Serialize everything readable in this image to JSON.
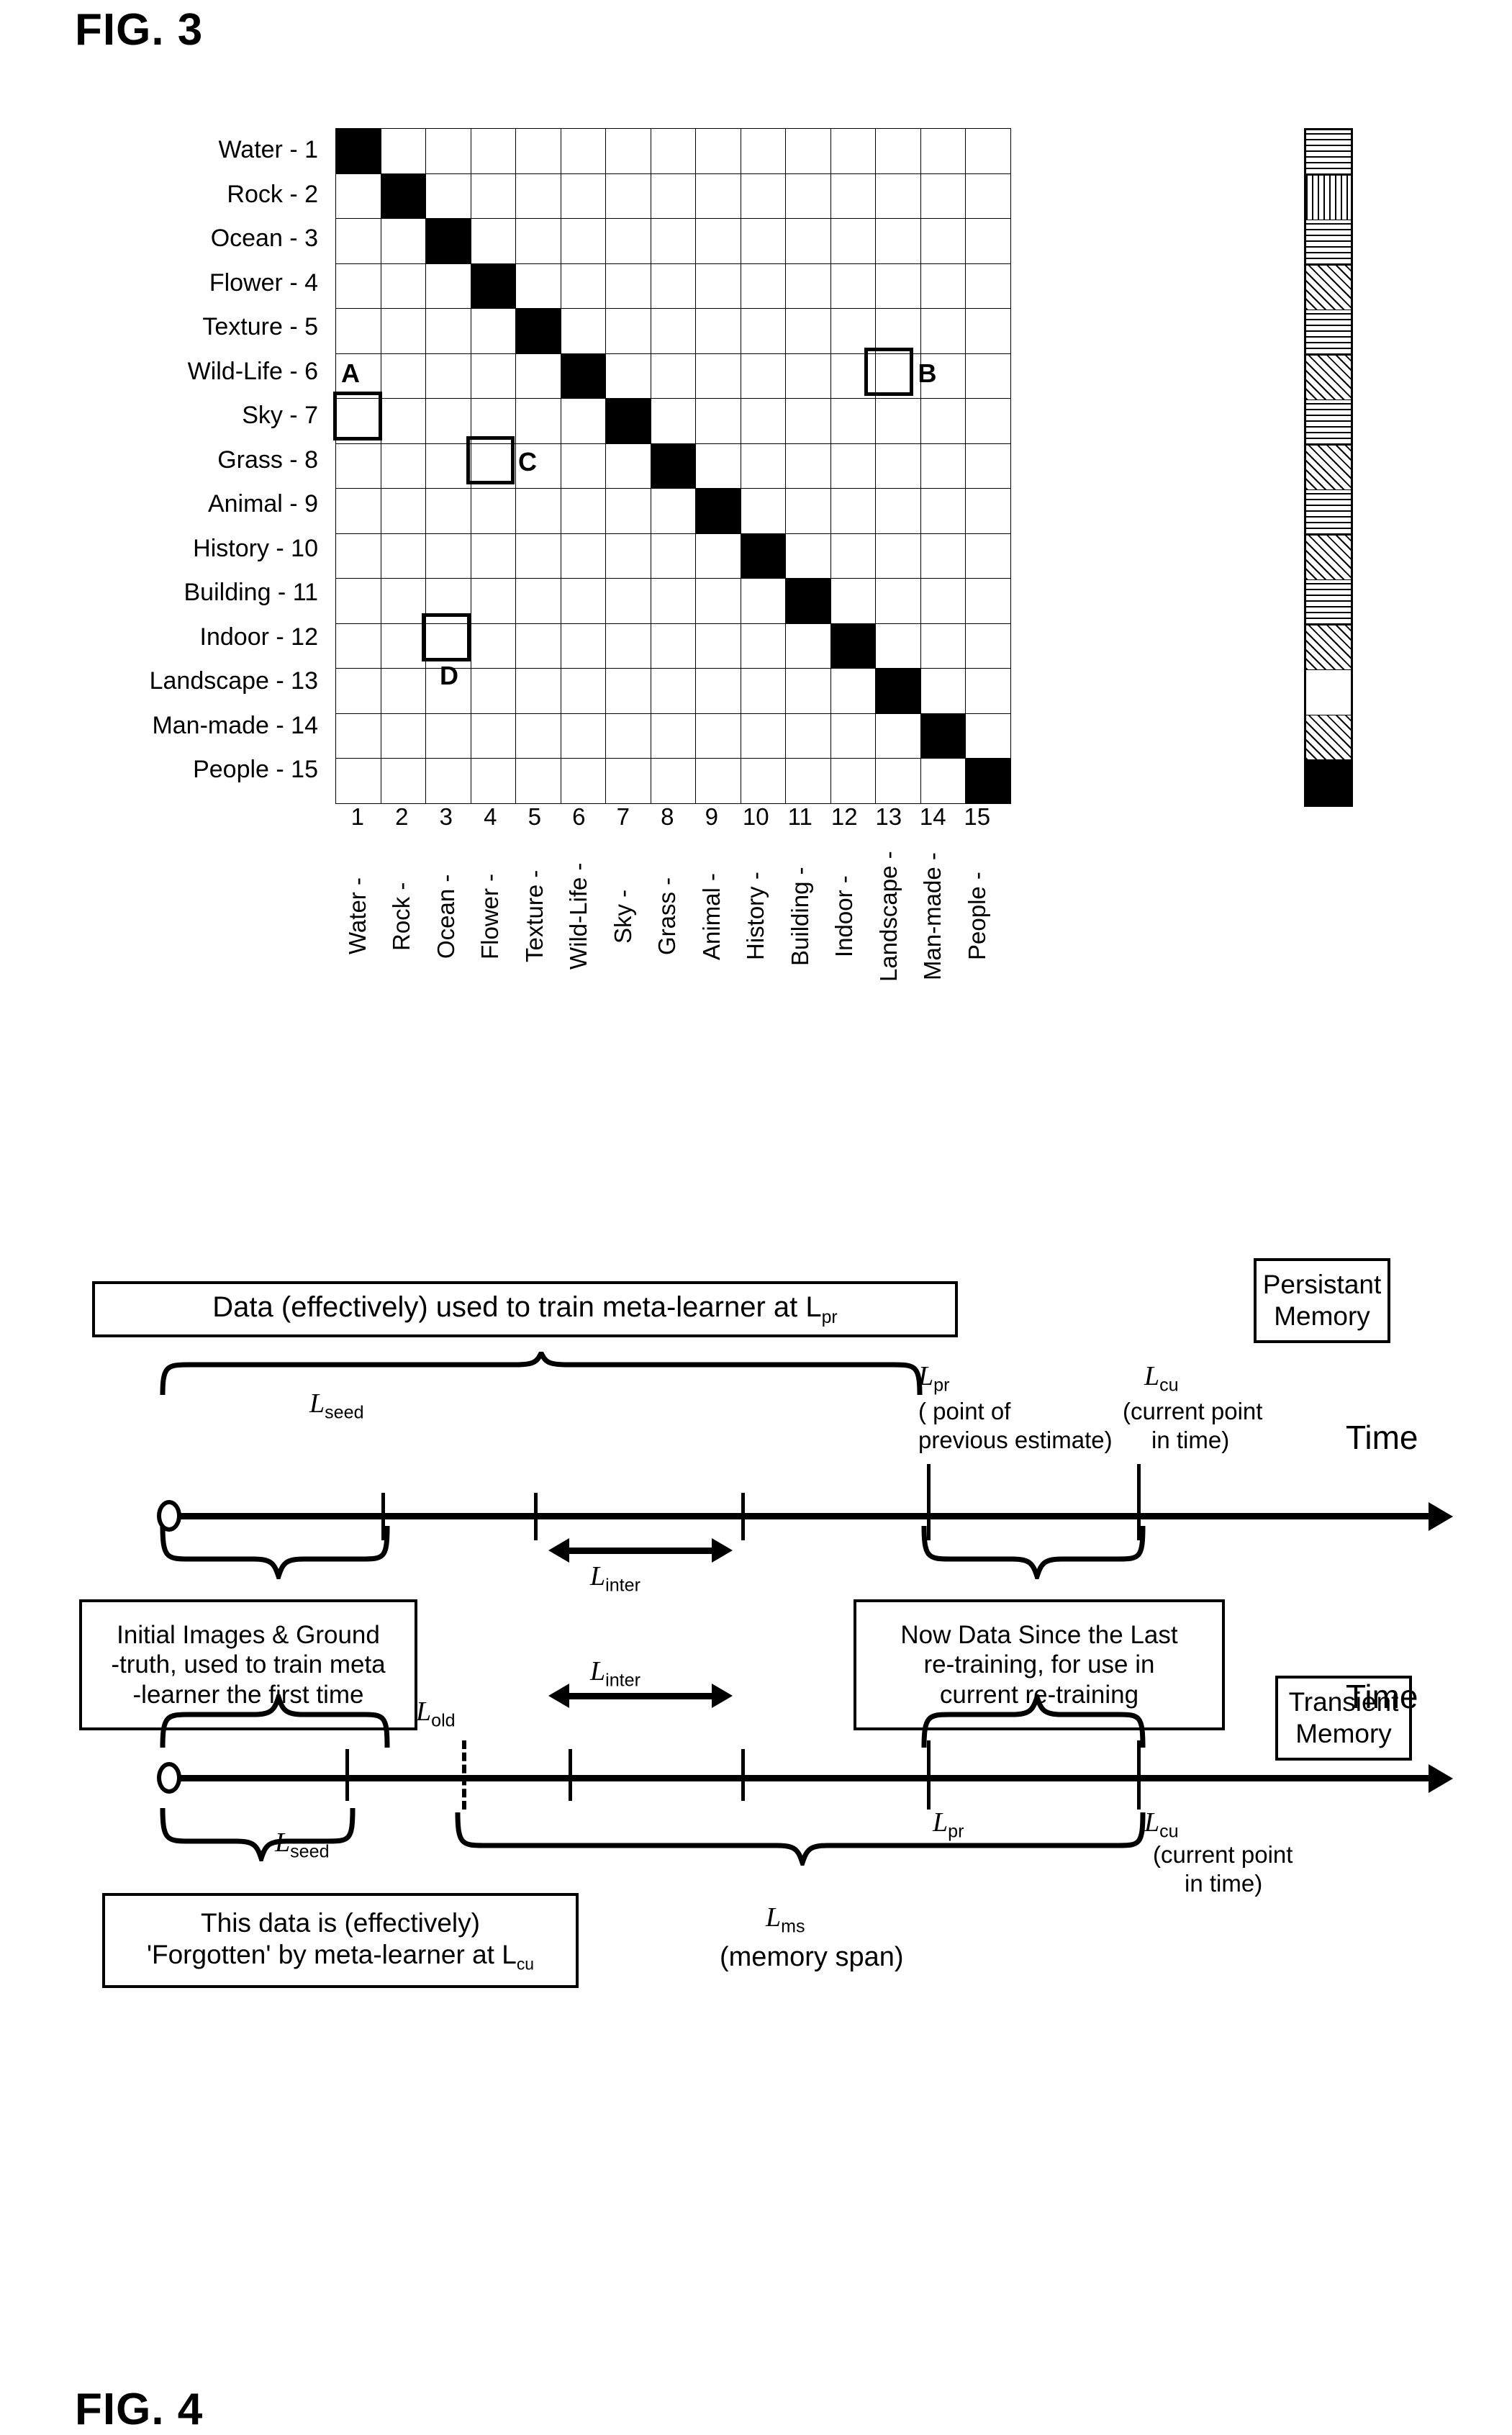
{
  "fig3": {
    "title": "FIG. 3",
    "row_labels": [
      "Water - 1",
      "Rock - 2",
      "Ocean - 3",
      "Flower - 4",
      "Texture - 5",
      "Wild-Life - 6",
      "Sky - 7",
      "Grass - 8",
      "Animal - 9",
      "History - 10",
      "Building - 11",
      "Indoor - 12",
      "Landscape - 13",
      "Man-made - 14",
      "People - 15"
    ],
    "col_numbers": [
      "1",
      "2",
      "3",
      "4",
      "5",
      "6",
      "7",
      "8",
      "9",
      "10",
      "11",
      "12",
      "13",
      "14",
      "15"
    ],
    "col_names": [
      "Water -",
      "Rock -",
      "Ocean -",
      "Flower -",
      "Texture -",
      "Wild-Life -",
      "Sky -",
      "Grass -",
      "Animal -",
      "History -",
      "Building -",
      "Indoor -",
      "Landscape -",
      "Man-made -",
      "People -"
    ],
    "highlights": [
      {
        "label": "A",
        "row": 7,
        "col": 1
      },
      {
        "label": "B",
        "row": 6,
        "col": 13
      },
      {
        "label": "C",
        "row": 8,
        "col": 4
      },
      {
        "label": "D",
        "row": 12,
        "col": 3
      }
    ]
  },
  "fig4": {
    "title": "FIG. 4",
    "top_box": "Data (effectively) used to train meta-learner at L",
    "top_box_sub": "pr",
    "persistent_memory": [
      "Persistant",
      "Memory"
    ],
    "transient_memory": [
      "Transient",
      "Memory"
    ],
    "timeline1": {
      "labels": {
        "seed": "L",
        "seed_sub": "seed",
        "inter": "L",
        "inter_sub": "inter",
        "pr": "L",
        "pr_sub": "pr",
        "pr_note1": "( point of",
        "pr_note2": "previous estimate)",
        "cu": "L",
        "cu_sub": "cu",
        "cu_note1": "(current point",
        "cu_note2": "in time)",
        "time": "Time"
      }
    },
    "timeline2": {
      "labels": {
        "seed": "L",
        "seed_sub": "seed",
        "old": "L",
        "old_sub": "old",
        "inter": "L",
        "inter_sub": "inter",
        "pr": "L",
        "pr_sub": "pr",
        "cu": "L",
        "cu_sub": "cu",
        "cu_note1": "(current point",
        "cu_note2": "in time)",
        "ms": "L",
        "ms_sub": "ms",
        "ms_note": "(memory span)",
        "time": "Time"
      }
    },
    "box_initial": [
      "Initial Images & Ground",
      "-truth, used to train meta",
      "-learner the first time"
    ],
    "box_now": [
      "Now Data Since the Last",
      "re-training, for use in",
      "current re-training"
    ],
    "box_forgotten_l1": "This data is (effectively)",
    "box_forgotten_l2a": "'Forgotten' by meta-learner at L",
    "box_forgotten_l2b": "cu"
  },
  "chart_data": {
    "type": "heatmap",
    "title": "FIG. 3",
    "categories": [
      "Water",
      "Rock",
      "Ocean",
      "Flower",
      "Texture",
      "Wild-Life",
      "Sky",
      "Grass",
      "Animal",
      "History",
      "Building",
      "Indoor",
      "Landscape",
      "Man-made",
      "People"
    ],
    "pattern_legend": {
      "p-solid": "solid black (self / diagonal)",
      "p-blank": "blank / white",
      "p-d1": "diagonal hatch medium",
      "p-d2": "diagonal hatch dense",
      "p-d3": "diagonal hatch sparse",
      "p-b1": "back-diagonal hatch medium",
      "p-b2": "back-diagonal hatch dense",
      "p-b3": "back-diagonal hatch sparse",
      "p-h1": "horizontal lines medium",
      "p-h2": "horizontal lines dense",
      "p-v1": "vertical lines medium",
      "p-v2": "vertical lines dense",
      "p-x1": "cross hatch diagonal",
      "p-g1": "grid cross hatch"
    },
    "cells": [
      [
        "p-solid",
        "p-d1",
        "p-h1",
        "p-d2",
        "p-b1",
        "p-d1",
        "p-h1",
        "p-d1",
        "p-b1",
        "p-d2",
        "p-b2",
        "p-d1",
        "p-b1",
        "p-h1",
        "p-d1"
      ],
      [
        "p-d1",
        "p-solid",
        "p-b1",
        "p-d2",
        "p-b2",
        "p-d1",
        "p-d2",
        "p-b1",
        "p-d1",
        "p-d2",
        "p-b1",
        "p-d2",
        "p-b1",
        "p-d1",
        "p-b1"
      ],
      [
        "p-b1",
        "p-d1",
        "p-solid",
        "p-b2",
        "p-d2",
        "p-b1",
        "p-d1",
        "p-b1",
        "p-d1",
        "p-d2",
        "p-b2",
        "p-d1",
        "p-b1",
        "p-d2",
        "p-b1"
      ],
      [
        "p-b1",
        "p-d2",
        "p-b2",
        "p-solid",
        "p-d2",
        "p-b1",
        "p-d1",
        "p-b2",
        "p-d1",
        "p-d2",
        "p-b1",
        "p-d1",
        "p-b2",
        "p-d1",
        "p-b1"
      ],
      [
        "p-d2",
        "p-b2",
        "p-d2",
        "p-b2",
        "p-solid",
        "p-d1",
        "p-b1",
        "p-d2",
        "p-b1",
        "p-d2",
        "p-b1",
        "p-d2",
        "p-b1",
        "p-d1",
        "p-b2"
      ],
      [
        "p-blank",
        "p-d1",
        "p-v1",
        "p-b1",
        "p-d2",
        "p-solid",
        "p-d1",
        "p-b1",
        "p-d1",
        "p-b1",
        "p-d1",
        "p-b1",
        "p-d1",
        "p-b1",
        "p-d1"
      ],
      [
        "p-blank",
        "p-d1",
        "p-h1",
        "p-b1",
        "p-d1",
        "p-h2",
        "p-solid",
        "p-d1",
        "p-b1",
        "p-d1",
        "p-v1",
        "p-b1",
        "p-d1",
        "p-b1",
        "p-d1"
      ],
      [
        "p-b1",
        "p-d1",
        "p-b1",
        "p-h2",
        "p-d1",
        "p-b1",
        "p-d1",
        "p-solid",
        "p-b1",
        "p-d1",
        "p-b1",
        "p-d1",
        "p-b1",
        "p-d1",
        "p-b1"
      ],
      [
        "p-d1",
        "p-blank",
        "p-blank",
        "p-b1",
        "p-h2",
        "p-d1",
        "p-h2",
        "p-b1",
        "p-solid",
        "p-d1",
        "p-b1",
        "p-d1",
        "p-b1",
        "p-d1",
        "p-b1"
      ],
      [
        "p-d2",
        "p-d2",
        "p-d2",
        "p-d2",
        "p-d2",
        "p-d2",
        "p-d2",
        "p-d2",
        "p-d2",
        "p-solid",
        "p-d2",
        "p-d2",
        "p-d2",
        "p-d2",
        "p-d2"
      ],
      [
        "p-b1",
        "p-d1",
        "p-b1",
        "p-d1",
        "p-b1",
        "p-d1",
        "p-b1",
        "p-d1",
        "p-b1",
        "p-d1",
        "p-solid",
        "p-b1",
        "p-d1",
        "p-b1",
        "p-d1"
      ],
      [
        "p-d1",
        "p-b1",
        "p-d2",
        "p-h1",
        "p-b1",
        "p-h1",
        "p-d1",
        "p-b1",
        "p-d1",
        "p-b1",
        "p-d1",
        "p-solid",
        "p-b1",
        "p-d1",
        "p-b1"
      ],
      [
        "p-b1",
        "p-d1",
        "p-b1",
        "p-d1",
        "p-h1",
        "p-b1",
        "p-d1",
        "p-h1",
        "p-b1",
        "p-h1",
        "p-d1",
        "p-v1",
        "p-solid",
        "p-b1",
        "p-d1"
      ],
      [
        "p-h1",
        "p-b1",
        "p-h1",
        "p-d1",
        "p-b1",
        "p-h1",
        "p-d1",
        "p-b1",
        "p-h1",
        "p-d1",
        "p-b1",
        "p-v1",
        "p-h1",
        "p-solid",
        "p-h1"
      ],
      [
        "p-h1",
        "p-v2",
        "p-h1",
        "p-b1",
        "p-h2",
        "p-h1",
        "p-h2",
        "p-h1",
        "p-b1",
        "p-h1",
        "p-h1",
        "p-v2",
        "p-v2",
        "p-h1",
        "p-solid"
      ]
    ],
    "strip": [
      "p-h1",
      "p-v1",
      "p-h1",
      "p-d1",
      "p-h1",
      "p-d1",
      "p-h1",
      "p-d1",
      "p-h1",
      "p-d1",
      "p-h1",
      "p-d1",
      "p-blank",
      "p-d1",
      "p-solid"
    ]
  }
}
